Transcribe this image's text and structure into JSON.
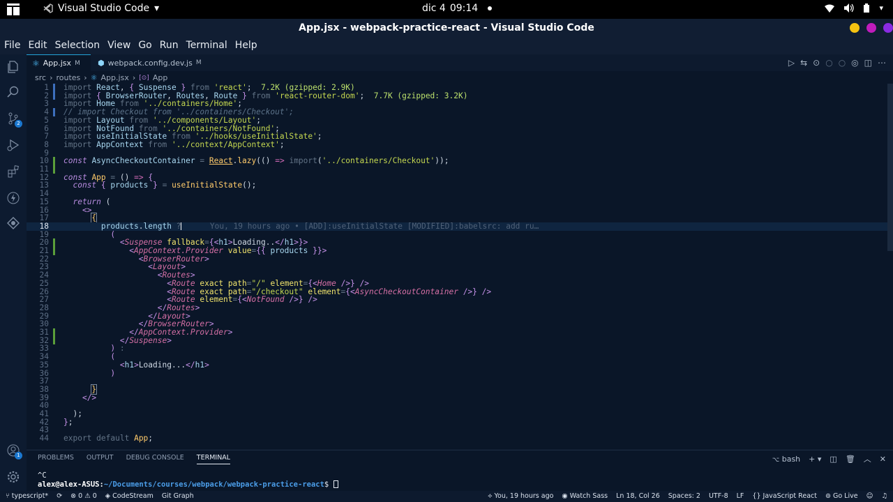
{
  "system_bar": {
    "app_name": "Visual Studio Code",
    "date": "dic 4",
    "time": "09:14"
  },
  "window": {
    "title": "App.jsx - webpack-practice-react - Visual Studio Code"
  },
  "menu": [
    "File",
    "Edit",
    "Selection",
    "View",
    "Go",
    "Run",
    "Terminal",
    "Help"
  ],
  "activity_badges": {
    "source_control": "2",
    "accounts": "1"
  },
  "tabs": [
    {
      "label": "App.jsx",
      "modified": "M"
    },
    {
      "label": "webpack.config.dev.js",
      "modified": "M"
    }
  ],
  "breadcrumb": [
    "src",
    "routes",
    "App.jsx",
    "App"
  ],
  "editor": {
    "lines": [
      {
        "n": "1"
      },
      {
        "n": "2"
      },
      {
        "n": "3"
      },
      {
        "n": "4"
      },
      {
        "n": "5"
      },
      {
        "n": "6"
      },
      {
        "n": "7"
      },
      {
        "n": "8"
      },
      {
        "n": "9"
      },
      {
        "n": "10"
      },
      {
        "n": "11"
      },
      {
        "n": "12"
      },
      {
        "n": "13"
      },
      {
        "n": "14"
      },
      {
        "n": "15"
      },
      {
        "n": "16"
      },
      {
        "n": "17"
      },
      {
        "n": "18"
      },
      {
        "n": "19"
      },
      {
        "n": "20"
      },
      {
        "n": "21"
      },
      {
        "n": "22"
      },
      {
        "n": "23"
      },
      {
        "n": "24"
      },
      {
        "n": "25"
      },
      {
        "n": "26"
      },
      {
        "n": "27"
      },
      {
        "n": "28"
      },
      {
        "n": "29"
      },
      {
        "n": "30"
      },
      {
        "n": "31"
      },
      {
        "n": "32"
      },
      {
        "n": "33"
      },
      {
        "n": "34"
      },
      {
        "n": "35"
      },
      {
        "n": "36"
      },
      {
        "n": "37"
      },
      {
        "n": "38"
      },
      {
        "n": "39"
      },
      {
        "n": "40"
      },
      {
        "n": "41"
      },
      {
        "n": "42"
      },
      {
        "n": "43"
      },
      {
        "n": "44"
      }
    ],
    "blame": "You, 19 hours ago • [ADD]:useInitialState [MODIFIED]:babelsrc: add ru…"
  },
  "panel": {
    "tabs": [
      "PROBLEMS",
      "OUTPUT",
      "DEBUG CONSOLE",
      "TERMINAL"
    ],
    "active_tab": "TERMINAL",
    "shell": "bash",
    "terminal_line1": "^C",
    "prompt_user": "alex@alex-ASUS",
    "prompt_path": "~/Documents/courses/webpack/webpack-practice-react",
    "prompt_suffix": "$"
  },
  "statusbar": {
    "left": [
      "typescript*",
      "⊗ 0 ⚠ 0",
      "CodeStream",
      "Git Graph"
    ],
    "right": [
      "You, 19 hours ago",
      "Watch Sass",
      "Ln 18, Col 26",
      "Spaces: 2",
      "UTF-8",
      "LF",
      "JavaScript React",
      "Go Live"
    ]
  },
  "colors": {
    "background": "#0a1628",
    "accent": "#22a3d8",
    "status_bar": "#0d1a2e"
  }
}
